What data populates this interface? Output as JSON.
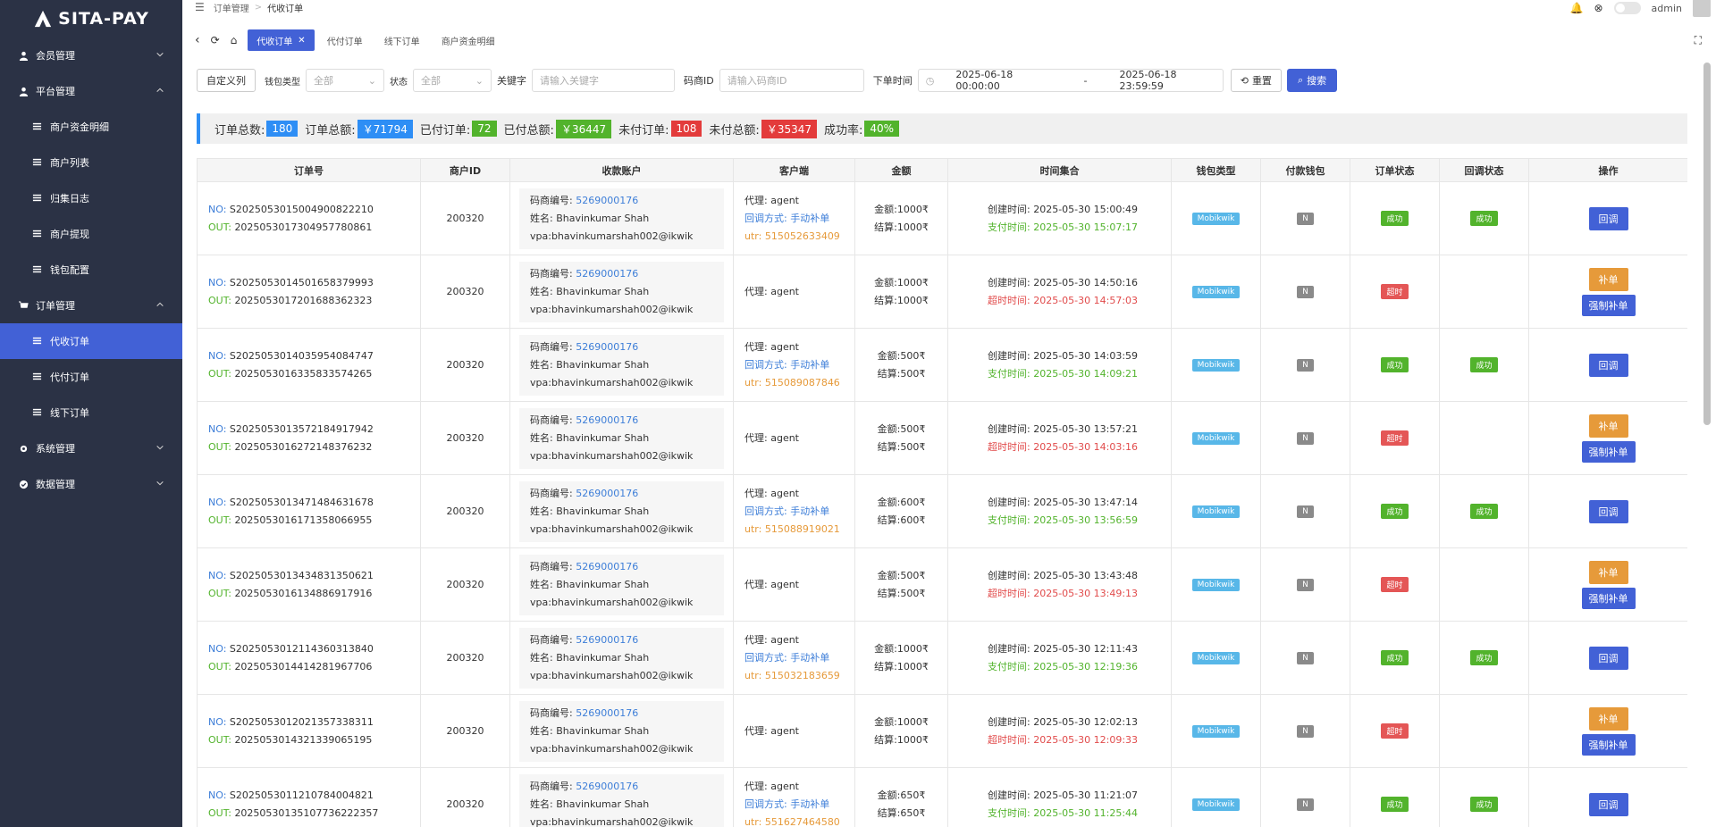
{
  "app": {
    "brand": "SITA-PAY",
    "user": "admin"
  },
  "breadcrumb": [
    "订单管理",
    "代收订单"
  ],
  "sidebar": {
    "groups": [
      {
        "label": "会员管理",
        "icon": "user-icon",
        "expanded": false
      },
      {
        "label": "平台管理",
        "icon": "user-icon",
        "expanded": true,
        "items": [
          {
            "label": "商户资金明细"
          },
          {
            "label": "商户列表"
          },
          {
            "label": "归集日志"
          },
          {
            "label": "商户提现"
          },
          {
            "label": "钱包配置"
          }
        ]
      },
      {
        "label": "订单管理",
        "icon": "cart-icon",
        "expanded": true,
        "items": [
          {
            "label": "代收订单",
            "active": true
          },
          {
            "label": "代付订单"
          },
          {
            "label": "线下订单"
          }
        ]
      },
      {
        "label": "系统管理",
        "icon": "gear-icon",
        "expanded": false
      },
      {
        "label": "数据管理",
        "icon": "check-circle-icon",
        "expanded": false
      }
    ]
  },
  "tabs": [
    {
      "label": "代收订单",
      "active": true
    },
    {
      "label": "代付订单"
    },
    {
      "label": "线下订单"
    },
    {
      "label": "商户资金明细"
    }
  ],
  "filters": {
    "custom_columns": "自定义列",
    "wallet_label": "钱包类型",
    "wallet_value": "全部",
    "status_label": "状态",
    "status_value": "全部",
    "keyword_label": "关键字",
    "keyword_placeholder": "请输入关键字",
    "merchant_label": "码商ID",
    "merchant_placeholder": "请输入码商ID",
    "time_label": "下单时间",
    "time_start": "2025-06-18 00:00:00",
    "time_sep": "-",
    "time_end": "2025-06-18 23:59:59",
    "reset": "重置",
    "search": "搜索"
  },
  "summary": [
    {
      "label": "订单总数:",
      "value": "180",
      "color": "#2e8ef5"
    },
    {
      "label": "订单总额:",
      "value": "￥71794",
      "color": "#2e8ef5"
    },
    {
      "label": "已付订单:",
      "value": "72",
      "color": "#52b32c"
    },
    {
      "label": "已付总额:",
      "value": "￥36447",
      "color": "#52b32c"
    },
    {
      "label": "未付订单:",
      "value": "108",
      "color": "#e33b3b"
    },
    {
      "label": "未付总额:",
      "value": "￥35347",
      "color": "#e33b3b"
    },
    {
      "label": "成功率:",
      "value": "40%",
      "color": "#52b32c"
    }
  ],
  "columns": [
    "订单号",
    "商户ID",
    "收款账户",
    "客户端",
    "金额",
    "时间集合",
    "钱包类型",
    "付款钱包",
    "订单状态",
    "回调状态",
    "操作"
  ],
  "labels": {
    "no": "NO:",
    "out": "OUT:",
    "code": "码商编号:",
    "name": "姓名:",
    "vpa": "vpa:",
    "agent": "代理:",
    "cb_method": "回调方式:",
    "utr": "utr:",
    "amount": "金额:",
    "settle": "结算:",
    "created": "创建时间:",
    "paid": "支付时间:",
    "timeout": "超时时间:"
  },
  "rows": [
    {
      "no": "S20250530150049008222​10",
      "out": "20250530173049577808​61",
      "mid": "200320",
      "code": "5269000176",
      "name": "Bhavinkumar Shah",
      "vpa": "bhavinkumarshah002@ikwik",
      "agent": "agent",
      "cb": "手动补单",
      "utr": "515052633409",
      "amount": "1000₹",
      "settle": "1000₹",
      "created": "2025-05-30 15:00:49",
      "t2label": "支付时间:",
      "t2": "2025-05-30 15:07:17",
      "paid": true,
      "wallet": "Mobikwik",
      "pw": "N",
      "status": "成功",
      "cbstatus": "成功"
    },
    {
      "no": "S20250530145016583799​93",
      "out": "20250530172016883623​23",
      "mid": "200320",
      "code": "5269000176",
      "name": "Bhavinkumar Shah",
      "vpa": "bhavinkumarshah002@ikwik",
      "agent": "agent",
      "cb": "",
      "utr": "",
      "amount": "1000₹",
      "settle": "1000₹",
      "created": "2025-05-30 14:50:16",
      "t2label": "超时时间:",
      "t2": "2025-05-30 14:57:03",
      "paid": false,
      "wallet": "Mobikwik",
      "pw": "N",
      "status": "超时",
      "cbstatus": ""
    },
    {
      "no": "S20250530140359540847​47",
      "out": "20250530163358335742​65",
      "mid": "200320",
      "code": "5269000176",
      "name": "Bhavinkumar Shah",
      "vpa": "bhavinkumarshah002@ikwik",
      "agent": "agent",
      "cb": "手动补单",
      "utr": "515089087846",
      "amount": "500₹",
      "settle": "500₹",
      "created": "2025-05-30 14:03:59",
      "t2label": "支付时间:",
      "t2": "2025-05-30 14:09:21",
      "paid": true,
      "wallet": "Mobikwik",
      "pw": "N",
      "status": "成功",
      "cbstatus": "成功"
    },
    {
      "no": "S20250530135721849179​42",
      "out": "20250530162721483762​32",
      "mid": "200320",
      "code": "5269000176",
      "name": "Bhavinkumar Shah",
      "vpa": "bhavinkumarshah002@ikwik",
      "agent": "agent",
      "cb": "",
      "utr": "",
      "amount": "500₹",
      "settle": "500₹",
      "created": "2025-05-30 13:57:21",
      "t2label": "超时时间:",
      "t2": "2025-05-30 14:03:16",
      "paid": false,
      "wallet": "Mobikwik",
      "pw": "N",
      "status": "超时",
      "cbstatus": ""
    },
    {
      "no": "S20250530134714846316​78",
      "out": "20250530161713580669​55",
      "mid": "200320",
      "code": "5269000176",
      "name": "Bhavinkumar Shah",
      "vpa": "bhavinkumarshah002@ikwik",
      "agent": "agent",
      "cb": "手动补单",
      "utr": "515088919021",
      "amount": "600₹",
      "settle": "600₹",
      "created": "2025-05-30 13:47:14",
      "t2label": "支付时间:",
      "t2": "2025-05-30 13:56:59",
      "paid": true,
      "wallet": "Mobikwik",
      "pw": "N",
      "status": "成功",
      "cbstatus": "成功"
    },
    {
      "no": "S20250530134348313506​21",
      "out": "20250530161348869179​16",
      "mid": "200320",
      "code": "5269000176",
      "name": "Bhavinkumar Shah",
      "vpa": "bhavinkumarshah002@ikwik",
      "agent": "agent",
      "cb": "",
      "utr": "",
      "amount": "500₹",
      "settle": "500₹",
      "created": "2025-05-30 13:43:48",
      "t2label": "超时时间:",
      "t2": "2025-05-30 13:49:13",
      "paid": false,
      "wallet": "Mobikwik",
      "pw": "N",
      "status": "超时",
      "cbstatus": ""
    },
    {
      "no": "S20250530121143603138​40",
      "out": "20250530144142819677​06",
      "mid": "200320",
      "code": "5269000176",
      "name": "Bhavinkumar Shah",
      "vpa": "bhavinkumarshah002@ikwik",
      "agent": "agent",
      "cb": "手动补单",
      "utr": "515032183659",
      "amount": "1000₹",
      "settle": "1000₹",
      "created": "2025-05-30 12:11:43",
      "t2label": "支付时间:",
      "t2": "2025-05-30 12:19:36",
      "paid": true,
      "wallet": "Mobikwik",
      "pw": "N",
      "status": "成功",
      "cbstatus": "成功"
    },
    {
      "no": "S20250530120213573383​11",
      "out": "20250530143213390651​95",
      "mid": "200320",
      "code": "5269000176",
      "name": "Bhavinkumar Shah",
      "vpa": "bhavinkumarshah002@ikwik",
      "agent": "agent",
      "cb": "",
      "utr": "",
      "amount": "1000₹",
      "settle": "1000₹",
      "created": "2025-05-30 12:02:13",
      "t2label": "超时时间:",
      "t2": "2025-05-30 12:09:33",
      "paid": false,
      "wallet": "Mobikwik",
      "pw": "N",
      "status": "超时",
      "cbstatus": ""
    },
    {
      "no": "S20250530112107840048​21",
      "out": "20250530135107736222​357",
      "mid": "200320",
      "code": "5269000176",
      "name": "Bhavinkumar Shah",
      "vpa": "bhavinkumarshah002@ikwik",
      "agent": "agent",
      "cb": "手动补单",
      "utr": "551627464580",
      "amount": "650₹",
      "settle": "650₹",
      "created": "2025-05-30 11:21:07",
      "t2label": "支付时间:",
      "t2": "2025-05-30 11:25:44",
      "paid": true,
      "wallet": "Mobikwik",
      "pw": "N",
      "status": "成功",
      "cbstatus": "成功"
    }
  ],
  "actions": {
    "callback": "回调",
    "supplement": "补单",
    "force": "强制补单"
  }
}
